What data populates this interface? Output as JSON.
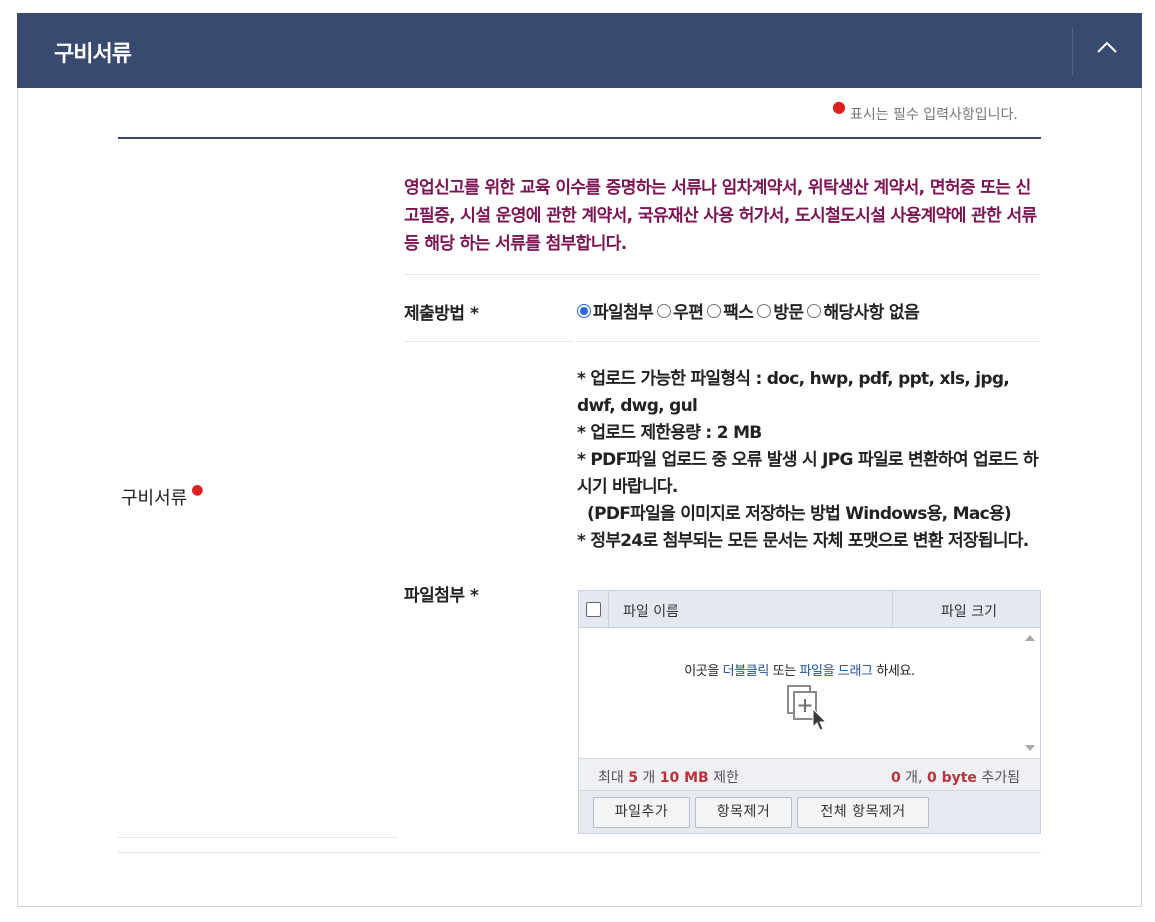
{
  "header": {
    "title": "구비서류",
    "collapse_icon": "chevron-up-icon"
  },
  "required_note": "표시는 필수 입력사항입니다.",
  "section": {
    "label": "구비서류",
    "description": "영업신고를 위한 교육 이수를 증명하는 서류나 임차계약서, 위탁생산 계약서, 면허증 또는 신고필증, 시설 운영에 관한 계약서, 국유재산 사용 허가서, 도시철도시설 사용계약에 관한 서류 등 해당 하는 서류를 첨부합니다.",
    "submit_method": {
      "label": "제출방법 *",
      "options": [
        "파일첨부",
        "우편",
        "팩스",
        "방문",
        "해당사항 없음"
      ],
      "selected": "파일첨부"
    },
    "file_attach": {
      "label": "파일첨부 *",
      "info_lines": [
        "* 업로드 가능한 파일형식 : doc, hwp, pdf, ppt, xls, jpg, dwf, dwg, gul",
        "* 업로드 제한용량 : 2 MB",
        "* PDF파일 업로드 중 오류 발생 시 JPG 파일로 변환하여 업로드 하시기 바랍니다.",
        "(PDF파일을 이미지로 저장하는 방법  Windows용, Mac용)",
        "* 정부24로 첨부되는 모든 문서는 자체 포맷으로 변환 저장됩니다."
      ]
    }
  },
  "uploader": {
    "col_name": "파일 이름",
    "col_size": "파일 크기",
    "drop": {
      "pre": "이곳을 ",
      "dbl": "더블클릭",
      "mid1": " 또는 ",
      "file": "파일을 드래그",
      "post": " 하세요."
    },
    "status": {
      "max_prefix": "최대 ",
      "max_count": "5",
      "count_unit": " 개 ",
      "max_size": "10 MB",
      "limit_suffix": " 제한",
      "added_count": "0",
      "added_unit": " 개, ",
      "added_size": "0 byte",
      "added_suffix": " 추가됨"
    },
    "buttons": {
      "add": "파일추가",
      "remove": "항목제거",
      "remove_all": "전체 항목제거"
    }
  },
  "colors": {
    "header_bg": "#394a70",
    "description_text": "#7a1452",
    "required_dot": "#e02020",
    "count_highlight": "#b9333b",
    "link_highlight": "#1d4f9c"
  }
}
